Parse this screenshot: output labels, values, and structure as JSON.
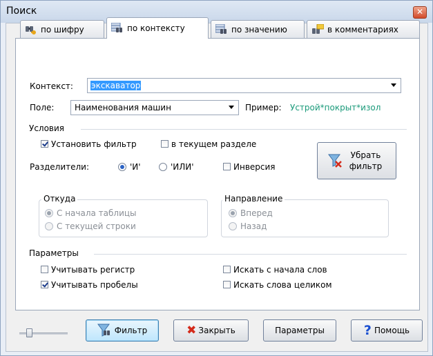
{
  "window": {
    "title": "Поиск"
  },
  "tabs": [
    {
      "label": "по шифру",
      "icon": "binoculars-key-icon"
    },
    {
      "label": "по контексту",
      "icon": "binoculars-table-icon",
      "active": true
    },
    {
      "label": "по значению",
      "icon": "binoculars-table-icon"
    },
    {
      "label": "в комментариях",
      "icon": "binoculars-comment-icon"
    }
  ],
  "context": {
    "label": "Контекст:",
    "value": "экскаватор"
  },
  "field": {
    "label": "Поле:",
    "value": "Наименования машин",
    "example_label": "Пример:",
    "example_value": "Устрой*покрыт*изол"
  },
  "conditions": {
    "title": "Условия",
    "set_filter": {
      "label": "Установить фильтр",
      "checked": true
    },
    "in_current_section": {
      "label": "в текущем разделе",
      "checked": false
    },
    "separators_label": "Разделители:",
    "sep_and": {
      "label": "'И'",
      "selected": true
    },
    "sep_or": {
      "label": "'ИЛИ'",
      "selected": false
    },
    "inversion": {
      "label": "Инверсия",
      "checked": false
    },
    "remove_filter_button": "Убрать фильтр"
  },
  "from": {
    "title": "Откуда",
    "opt1": "С начала таблицы",
    "opt2": "С текущей строки"
  },
  "direction": {
    "title": "Направление",
    "opt1": "Вперед",
    "opt2": "Назад"
  },
  "params": {
    "title": "Параметры",
    "case": {
      "label": "Учитывать регистр",
      "checked": false
    },
    "spaces": {
      "label": "Учитывать пробелы",
      "checked": true
    },
    "word_start": {
      "label": "Искать с начала слов",
      "checked": false
    },
    "whole_words": {
      "label": "Искать слова целиком",
      "checked": false
    }
  },
  "footer": {
    "filter_button": "Фильтр",
    "close_button": "Закрыть",
    "params_button": "Параметры",
    "help_button": "Помощь"
  },
  "colors": {
    "example_text": "#1a9a7a",
    "selection": "#3399ff",
    "close_x": "#d42a1a",
    "help_q": "#1a4fd0"
  }
}
